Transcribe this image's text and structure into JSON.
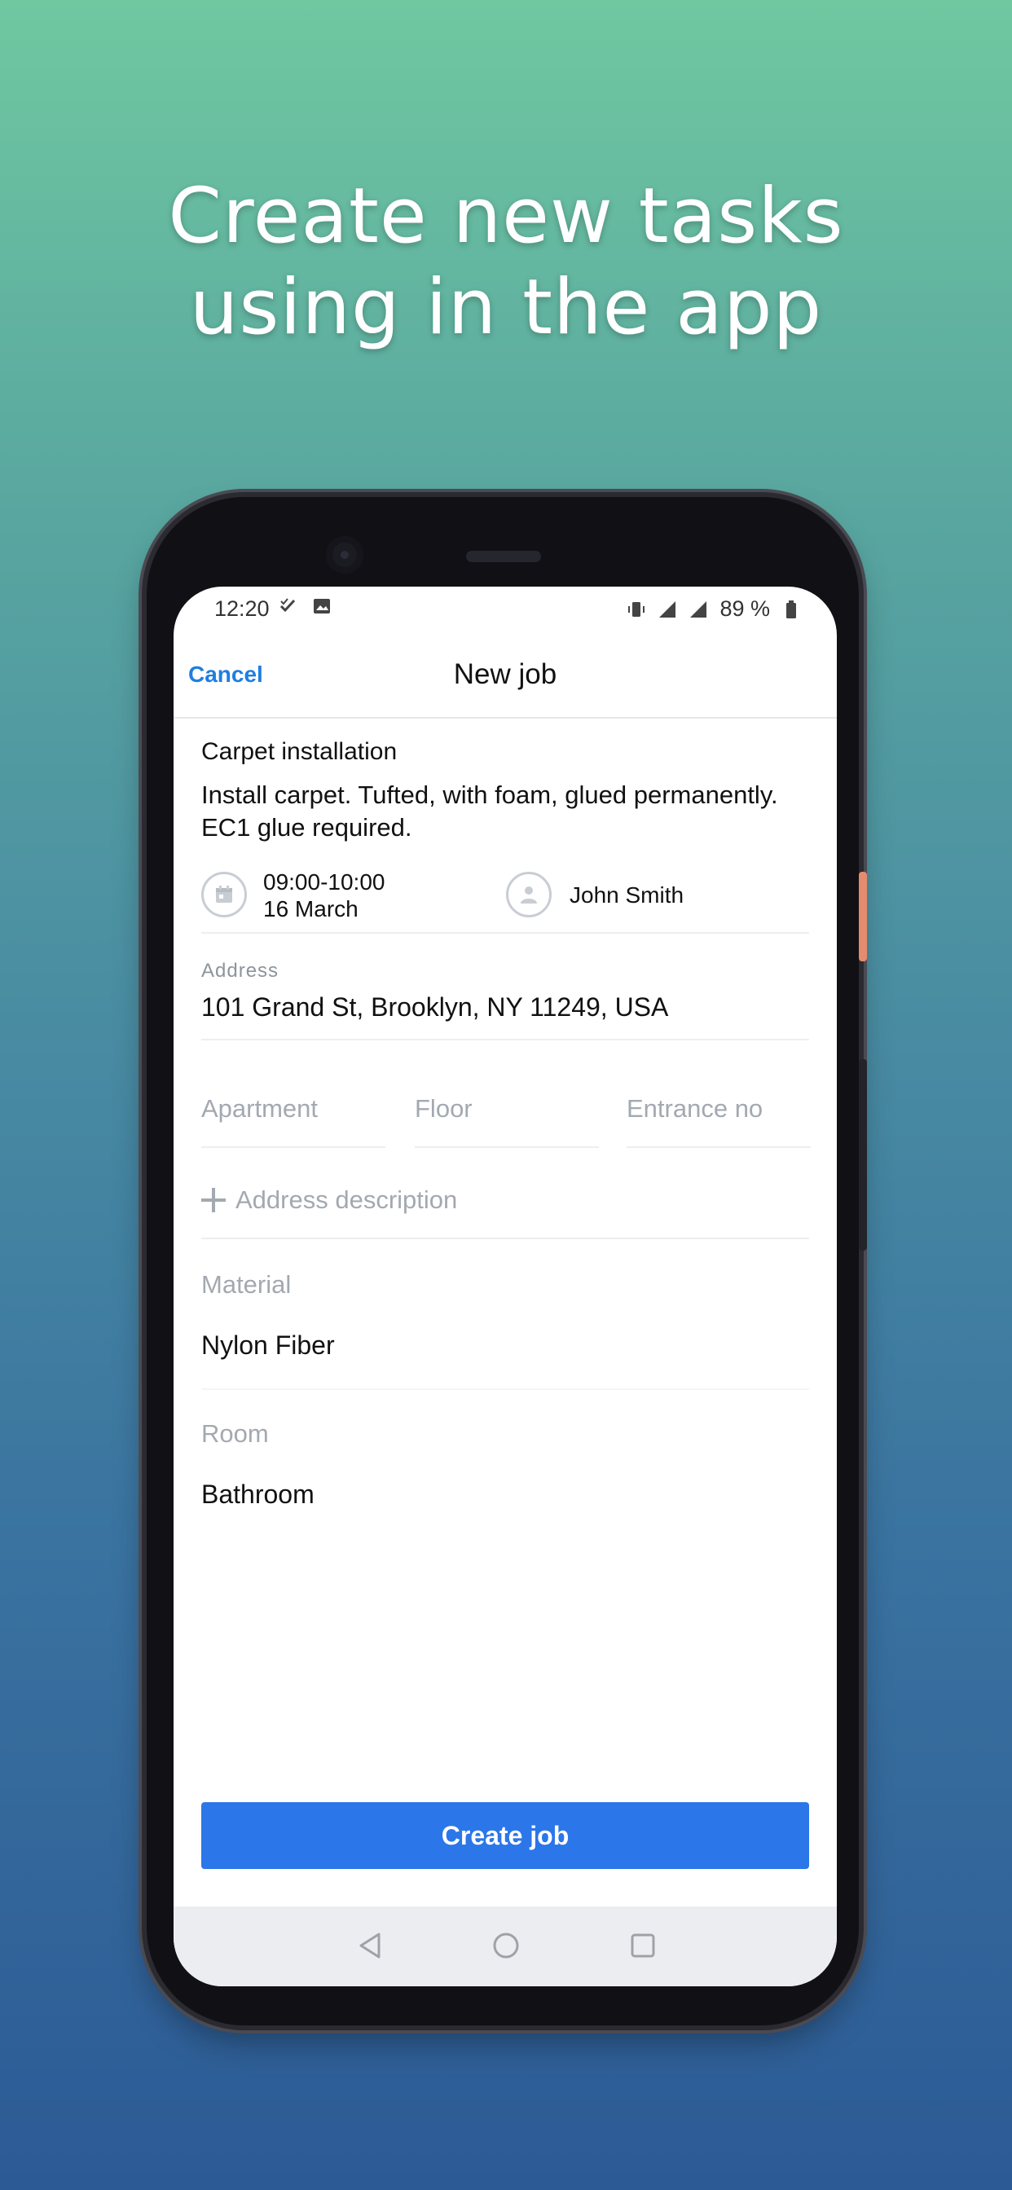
{
  "headline": {
    "line1": "Create new tasks",
    "line2": "using in the app"
  },
  "status_bar": {
    "time": "12:20",
    "battery": "89 %"
  },
  "header": {
    "cancel_label": "Cancel",
    "title": "New job"
  },
  "job": {
    "title": "Carpet installation",
    "description": "Install carpet. Tufted, with foam, glued permanently. EC1 glue required.",
    "time": "09:00-10:00",
    "date": "16 March",
    "assignee": "John Smith"
  },
  "address": {
    "label": "Address",
    "value": "101 Grand St, Brooklyn, NY 11249, USA",
    "apartment_placeholder": "Apartment",
    "floor_placeholder": "Floor",
    "entrance_placeholder": "Entrance no",
    "add_description_label": "Address description"
  },
  "material": {
    "label": "Material",
    "value": "Nylon Fiber"
  },
  "room": {
    "label": "Room",
    "value": "Bathroom"
  },
  "actions": {
    "create_label": "Create job"
  },
  "colors": {
    "accent": "#2b76e9",
    "cancel": "#1f7ee0"
  }
}
